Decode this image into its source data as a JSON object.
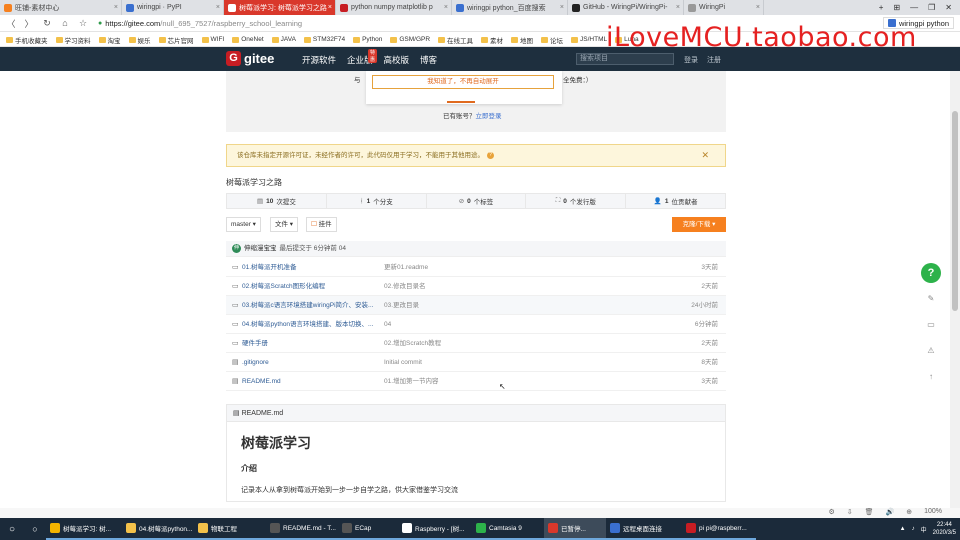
{
  "browser": {
    "tabs": [
      {
        "title": "旺铺-素材中心",
        "active": false,
        "color": "#f6801f"
      },
      {
        "title": "wiringpi · PyPI",
        "active": false,
        "color": "#3a6fcf"
      },
      {
        "title": "树莓派学习: 树莓派学习之路",
        "active": true,
        "color": "#ffffff"
      },
      {
        "title": "python numpy matplotlib p",
        "active": false,
        "color": "#c71d23"
      },
      {
        "title": "wiringpi python_百度搜索",
        "active": false,
        "color": "#3a6fcf"
      },
      {
        "title": "GitHub - WiringPi/WiringPi-",
        "active": false,
        "color": "#222222"
      },
      {
        "title": "WiringPi",
        "active": false,
        "color": "#999999"
      }
    ],
    "new_tab": "+",
    "win_controls": [
      "⊞",
      "—",
      "❐",
      "✕"
    ],
    "nav": {
      "back": "〈",
      "forward": "〉",
      "reload": "↻",
      "home": "⌂",
      "bookmark": "☆"
    },
    "address": {
      "lock": "🔒",
      "host": "https://gitee.com",
      "path": "/null_695_7527/raspberry_school_learning"
    },
    "search_box": "wiringpi python",
    "bookmarks": [
      "手机收藏夹",
      "学习资料",
      "淘宝",
      "娱乐",
      "芯片官网",
      "WIFI",
      "OneNet",
      "JAVA",
      "STM32F74",
      "Python",
      "GSM/GPR",
      "在线工具",
      "素材",
      "地图",
      "论坛",
      "JS/HTML",
      "Luna"
    ]
  },
  "watermark": "iLoveMCU.taobao.com",
  "gitee": {
    "logo_mark": "G",
    "logo_text": "gitee",
    "nav": [
      "开源软件",
      "企业版",
      "高校版",
      "博客"
    ],
    "special_badge": "特惠",
    "search_placeholder": "搜索项目",
    "login": "登录",
    "signup": "注册"
  },
  "login_prompt": {
    "popup_button": "我知道了，不再自动展开",
    "cut_left": "与",
    "cut_right": "全免费：）",
    "has_account": "已有账号？",
    "login_link": "立即登录"
  },
  "notice": {
    "text": "该仓库未指定开源许可证，未经作者的许可，此代码仅用于学习，不能用于其他用途。",
    "help": "?",
    "close": "✕"
  },
  "repo": {
    "title": "树莓派学习之路",
    "stats": [
      {
        "icon": "▤",
        "count": "10",
        "label": "次提交"
      },
      {
        "icon": "ᚮ",
        "count": "1",
        "label": "个分支"
      },
      {
        "icon": "⊘",
        "count": "0",
        "label": "个标签"
      },
      {
        "icon": "⛶",
        "count": "0",
        "label": "个发行版"
      },
      {
        "icon": "👤",
        "count": "1",
        "label": "位贡献者"
      }
    ],
    "branch": "master ▾",
    "file_menu": "文件 ▾",
    "mount": "挂件",
    "clone_btn": "克隆/下载 ▾"
  },
  "commit": {
    "avatar": "伸",
    "author": "伸缩漫宝宝",
    "text": "最后提交于 6分钟前 04"
  },
  "files": [
    {
      "icon": "folder",
      "name": "01.树莓派开机准备",
      "msg": "更新01.readme",
      "time": "3天前"
    },
    {
      "icon": "folder",
      "name": "02.树莓派Scratch图形化编程",
      "msg": "02.修改目录名",
      "time": "2天前"
    },
    {
      "icon": "folder",
      "name": "03.树莓派c语言环境搭建wiringPi简介、安装...",
      "msg": "03.更改目录",
      "time": "24小时前"
    },
    {
      "icon": "folder",
      "name": "04.树莓派python语言环境搭建、版本切换、...",
      "msg": "04",
      "time": "6分钟前"
    },
    {
      "icon": "folder",
      "name": "硬件手册",
      "msg": "02.增加Scratch教程",
      "time": "2天前"
    },
    {
      "icon": "file",
      "name": ".gitignore",
      "msg": "Initial commit",
      "time": "8天前"
    },
    {
      "icon": "file",
      "name": "README.md",
      "msg": "01.增加第一节内容",
      "time": "3天前"
    }
  ],
  "readme": {
    "filename": "README.md",
    "h1": "树莓派学习",
    "h2": "介绍",
    "p": "记录本人从拿到树莓派开始到一步一步自学之路，供大家借鉴学习交流"
  },
  "float_bar": {
    "help": "?",
    "icons": [
      "✎",
      "▭",
      "⚠",
      "↑"
    ]
  },
  "status_icons": [
    "⚙",
    "⇩",
    "🗑",
    "🔊",
    "⊕",
    "100%"
  ],
  "taskbar": {
    "start": "○",
    "search": "⊞",
    "tasks": [
      {
        "title": "树莓派学习: 树...",
        "color": "#f4b400",
        "active": false
      },
      {
        "title": "04.树莓派python...",
        "color": "#f3c14a",
        "active": false
      },
      {
        "title": "物联工程",
        "color": "#f3c14a",
        "active": false
      },
      {
        "title": "README.md - T...",
        "color": "#555555",
        "active": false
      },
      {
        "title": "ECap",
        "color": "#555555",
        "active": false
      },
      {
        "title": "Raspberry - [树...",
        "color": "#ffffff",
        "active": false
      },
      {
        "title": "Camtasia 9",
        "color": "#2db24a",
        "active": false
      },
      {
        "title": "已暂停...",
        "color": "#d9382b",
        "active": true
      },
      {
        "title": "远程桌面连接",
        "color": "#3a6fcf",
        "active": false
      },
      {
        "title": "pi pi@raspberr...",
        "color": "#c71d23",
        "active": false
      }
    ],
    "time": "22:44",
    "date": "2020/3/5"
  }
}
